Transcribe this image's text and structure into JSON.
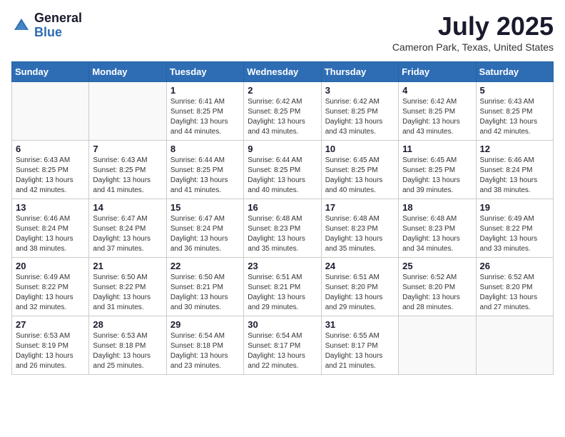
{
  "logo": {
    "general": "General",
    "blue": "Blue"
  },
  "header": {
    "title": "July 2025",
    "subtitle": "Cameron Park, Texas, United States"
  },
  "weekdays": [
    "Sunday",
    "Monday",
    "Tuesday",
    "Wednesday",
    "Thursday",
    "Friday",
    "Saturday"
  ],
  "weeks": [
    [
      {
        "day": "",
        "info": ""
      },
      {
        "day": "",
        "info": ""
      },
      {
        "day": "1",
        "info": "Sunrise: 6:41 AM\nSunset: 8:25 PM\nDaylight: 13 hours and 44 minutes."
      },
      {
        "day": "2",
        "info": "Sunrise: 6:42 AM\nSunset: 8:25 PM\nDaylight: 13 hours and 43 minutes."
      },
      {
        "day": "3",
        "info": "Sunrise: 6:42 AM\nSunset: 8:25 PM\nDaylight: 13 hours and 43 minutes."
      },
      {
        "day": "4",
        "info": "Sunrise: 6:42 AM\nSunset: 8:25 PM\nDaylight: 13 hours and 43 minutes."
      },
      {
        "day": "5",
        "info": "Sunrise: 6:43 AM\nSunset: 8:25 PM\nDaylight: 13 hours and 42 minutes."
      }
    ],
    [
      {
        "day": "6",
        "info": "Sunrise: 6:43 AM\nSunset: 8:25 PM\nDaylight: 13 hours and 42 minutes."
      },
      {
        "day": "7",
        "info": "Sunrise: 6:43 AM\nSunset: 8:25 PM\nDaylight: 13 hours and 41 minutes."
      },
      {
        "day": "8",
        "info": "Sunrise: 6:44 AM\nSunset: 8:25 PM\nDaylight: 13 hours and 41 minutes."
      },
      {
        "day": "9",
        "info": "Sunrise: 6:44 AM\nSunset: 8:25 PM\nDaylight: 13 hours and 40 minutes."
      },
      {
        "day": "10",
        "info": "Sunrise: 6:45 AM\nSunset: 8:25 PM\nDaylight: 13 hours and 40 minutes."
      },
      {
        "day": "11",
        "info": "Sunrise: 6:45 AM\nSunset: 8:25 PM\nDaylight: 13 hours and 39 minutes."
      },
      {
        "day": "12",
        "info": "Sunrise: 6:46 AM\nSunset: 8:24 PM\nDaylight: 13 hours and 38 minutes."
      }
    ],
    [
      {
        "day": "13",
        "info": "Sunrise: 6:46 AM\nSunset: 8:24 PM\nDaylight: 13 hours and 38 minutes."
      },
      {
        "day": "14",
        "info": "Sunrise: 6:47 AM\nSunset: 8:24 PM\nDaylight: 13 hours and 37 minutes."
      },
      {
        "day": "15",
        "info": "Sunrise: 6:47 AM\nSunset: 8:24 PM\nDaylight: 13 hours and 36 minutes."
      },
      {
        "day": "16",
        "info": "Sunrise: 6:48 AM\nSunset: 8:23 PM\nDaylight: 13 hours and 35 minutes."
      },
      {
        "day": "17",
        "info": "Sunrise: 6:48 AM\nSunset: 8:23 PM\nDaylight: 13 hours and 35 minutes."
      },
      {
        "day": "18",
        "info": "Sunrise: 6:48 AM\nSunset: 8:23 PM\nDaylight: 13 hours and 34 minutes."
      },
      {
        "day": "19",
        "info": "Sunrise: 6:49 AM\nSunset: 8:22 PM\nDaylight: 13 hours and 33 minutes."
      }
    ],
    [
      {
        "day": "20",
        "info": "Sunrise: 6:49 AM\nSunset: 8:22 PM\nDaylight: 13 hours and 32 minutes."
      },
      {
        "day": "21",
        "info": "Sunrise: 6:50 AM\nSunset: 8:22 PM\nDaylight: 13 hours and 31 minutes."
      },
      {
        "day": "22",
        "info": "Sunrise: 6:50 AM\nSunset: 8:21 PM\nDaylight: 13 hours and 30 minutes."
      },
      {
        "day": "23",
        "info": "Sunrise: 6:51 AM\nSunset: 8:21 PM\nDaylight: 13 hours and 29 minutes."
      },
      {
        "day": "24",
        "info": "Sunrise: 6:51 AM\nSunset: 8:20 PM\nDaylight: 13 hours and 29 minutes."
      },
      {
        "day": "25",
        "info": "Sunrise: 6:52 AM\nSunset: 8:20 PM\nDaylight: 13 hours and 28 minutes."
      },
      {
        "day": "26",
        "info": "Sunrise: 6:52 AM\nSunset: 8:20 PM\nDaylight: 13 hours and 27 minutes."
      }
    ],
    [
      {
        "day": "27",
        "info": "Sunrise: 6:53 AM\nSunset: 8:19 PM\nDaylight: 13 hours and 26 minutes."
      },
      {
        "day": "28",
        "info": "Sunrise: 6:53 AM\nSunset: 8:18 PM\nDaylight: 13 hours and 25 minutes."
      },
      {
        "day": "29",
        "info": "Sunrise: 6:54 AM\nSunset: 8:18 PM\nDaylight: 13 hours and 23 minutes."
      },
      {
        "day": "30",
        "info": "Sunrise: 6:54 AM\nSunset: 8:17 PM\nDaylight: 13 hours and 22 minutes."
      },
      {
        "day": "31",
        "info": "Sunrise: 6:55 AM\nSunset: 8:17 PM\nDaylight: 13 hours and 21 minutes."
      },
      {
        "day": "",
        "info": ""
      },
      {
        "day": "",
        "info": ""
      }
    ]
  ]
}
